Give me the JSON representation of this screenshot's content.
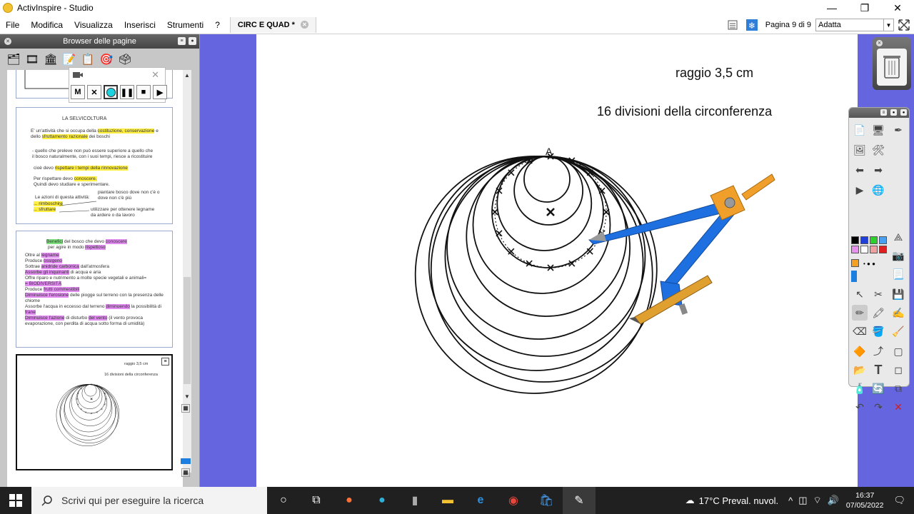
{
  "window": {
    "title": "ActivInspire - Studio",
    "controls": [
      "—",
      "❐",
      "✕"
    ]
  },
  "menu": {
    "items": [
      "File",
      "Modifica",
      "Visualizza",
      "Inserisci",
      "Strumenti",
      "?"
    ],
    "doc_tab": "CIRC E QUAD *",
    "page_indicator": "Pagina 9 di 9",
    "zoom_value": "Adatta"
  },
  "browser": {
    "title": "Browser delle pagine",
    "thumb_selvicoltura": {
      "title": "LA SELVICOLTURA",
      "line1a": "E' un'attività che si occupa della ",
      "line1b": "costituzione, conservazione",
      "line1c": " e",
      "line2a": "dello ",
      "line2b": "sfruttamento razionale",
      "line2c": " dei boschi",
      "line3": "- quello che preleve non può essere superiore a quello che",
      "line4": "il bosco naturalmente, con i suoi tempi, riesce a ricostituire",
      "line5a": "cioè devo ",
      "line5b": "rispettare i tempi della rinnovazione",
      "line6a": "Per rispettare devo ",
      "line6b": "conoscere.",
      "line7": "Quindi devo studiare e sperimentare.",
      "line8": "Le azioni di questa attività:",
      "line9": "... rimboschire",
      "line10": "... sfruttare",
      "note1": "piantare bosco dove non c'è o",
      "note2": "dove non c'è più",
      "note3": "utilizzare per ottenere legname",
      "note4": "da ardere o da lavoro"
    },
    "thumb_benefici": {
      "head1a": "Benefici",
      "head1b": " del bosco che devo ",
      "head1c": "conoscere",
      "head2a": "per agire in modo ",
      "head2b": "rispettoso",
      "l1a": "Oltre al ",
      "l1b": "legname",
      "l2a": "Produce ",
      "l2b": "ossigeno",
      "l3a": "Sottrae ",
      "l3b": "anidride carbonica",
      "l3c": " dall'atmosfera",
      "l4a": "Assorbe",
      "l4b": " gli inquinanti",
      "l4c": " di acqua e aria",
      "l5": "Offre riparo e nutrimento a molte specie vegetali e animali=",
      "l6": "= BIODIVERSITÀ",
      "l7a": "Produce ",
      "l7b": "frutti commestibili",
      "l8a": "Diminuisce l'erosione",
      "l8b": " delle piogge sul terreno con la presenza delle",
      "l9": "chiome",
      "l10a": "Assorbe l'acqua in eccesso dal terreno ",
      "l10b": "diminuendo",
      "l10c": " la possibilità di",
      "l11": "frane",
      "l12a": "Diminuisce l'azione",
      "l12b": " di disturbo ",
      "l12c": "del vento",
      "l12d": " (il vento provoca",
      "l13": "evaporazione, con perdita di acqua sotto forma di umidità)"
    },
    "thumb_current": {
      "line1": "raggio 3,5 cm",
      "line2": "16 divisioni della circonferenza"
    }
  },
  "recorder": {
    "buttons": [
      "M",
      "✕",
      "",
      "❚❚",
      "■",
      "▶"
    ]
  },
  "canvas": {
    "radius_label": "raggio 3,5 cm",
    "divisions_label": "16 divisioni della circonferenza",
    "point_label": "A"
  },
  "taskbar": {
    "search_placeholder": "Scrivi qui per eseguire la ricerca",
    "weather": "17°C  Preval. nuvol.",
    "time": "16:37",
    "date": "07/05/2022"
  }
}
